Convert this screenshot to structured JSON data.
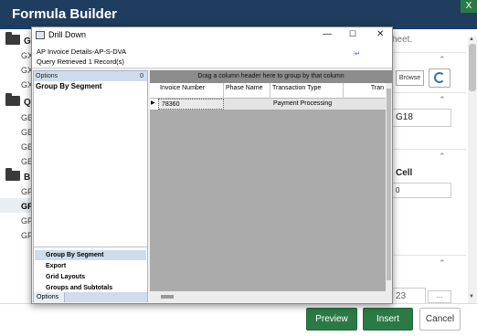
{
  "app": {
    "title": "Formula Builder"
  },
  "background_left": {
    "groups": [
      {
        "letter": "G",
        "items": [
          "GX",
          "GX",
          "GX"
        ]
      },
      {
        "letter": "Q",
        "items": [
          "GE",
          "GE",
          "GE",
          "GE"
        ]
      },
      {
        "letter": "B",
        "items": [
          "GP",
          "GP",
          "GP",
          "GP"
        ]
      }
    ]
  },
  "background_right": {
    "sheet_text": "heet.",
    "browse_label": "Browse",
    "cell_ref": "G18",
    "cell_label": "Cell",
    "cell_value": "0",
    "bottom_field": "23",
    "dots_label": "..."
  },
  "footer": {
    "preview_label": "Preview",
    "insert_label": "Insert",
    "cancel_label": "Cancel"
  },
  "dialog": {
    "title": "Drill Down",
    "info_line1": "AP Invoice Details-AP-S-DVA",
    "info_line2": "Query Retrieved 1 Record(s)",
    "options_header": "Options",
    "options_pin": "0",
    "selected_option": "Group By Segment",
    "nav_items": [
      "Group By Segment",
      "Export",
      "Grid Layouts",
      "Groups and Subtotals"
    ],
    "options_tab": "Options",
    "grid": {
      "drag_hint": "Drag a column header here to group by that column",
      "columns": [
        "Invoice Number",
        "Phase Name",
        "Transaction Type",
        "Tran"
      ],
      "rows": [
        {
          "invoice_number": "78360",
          "phase_name": "",
          "transaction_type": "Payment Processing",
          "tran": ""
        }
      ]
    }
  }
}
